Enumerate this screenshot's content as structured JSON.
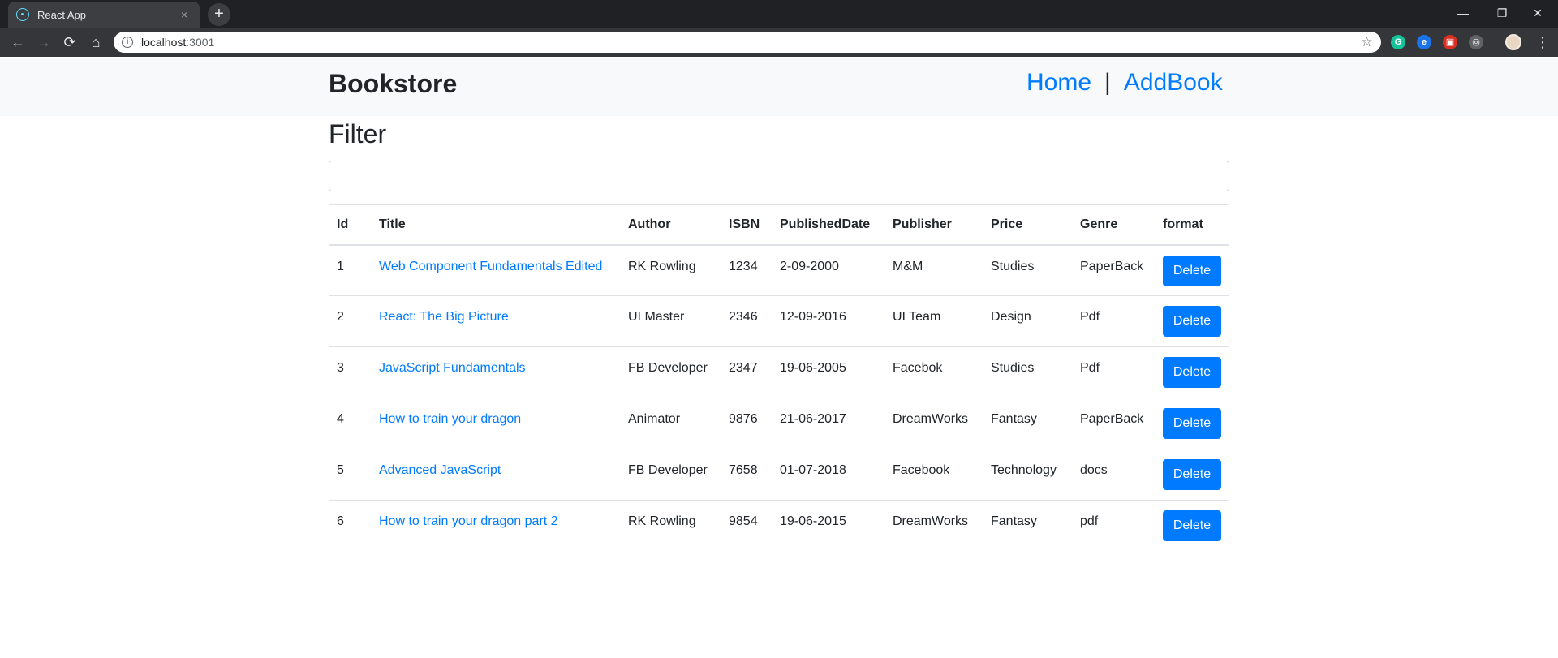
{
  "browser": {
    "tab_title": "React App",
    "tab_close": "×",
    "new_tab": "+",
    "back": "←",
    "forward": "→",
    "reload": "⟳",
    "home": "⌂",
    "url_host": "localhost",
    "url_port": ":3001",
    "star": "☆",
    "minimize": "—",
    "restore": "❐",
    "close": "✕",
    "menu": "⋮",
    "extensions": [
      {
        "name": "grammarly-icon",
        "glyph": "G",
        "color": "#15c39a"
      },
      {
        "name": "extension-blue-icon",
        "glyph": "e",
        "color": "#1a73e8"
      },
      {
        "name": "extension-red-icon",
        "glyph": "▣",
        "color": "#d93025"
      },
      {
        "name": "extension-target-icon",
        "glyph": "◎",
        "color": "#5f6368"
      }
    ]
  },
  "navbar": {
    "brand": "Bookstore",
    "links": [
      {
        "label": "Home"
      },
      {
        "label": "AddBook"
      }
    ],
    "separator": "|"
  },
  "filter": {
    "title": "Filter",
    "value": "",
    "placeholder": ""
  },
  "table": {
    "headers": [
      "Id",
      "Title",
      "Author",
      "ISBN",
      "PublishedDate",
      "Publisher",
      "Price",
      "Genre",
      "format"
    ],
    "rows": [
      {
        "id": "1",
        "title": "Web Component Fundamentals Edited",
        "author": "RK Rowling",
        "isbn": "1234",
        "date": "2-09-2000",
        "publisher": "M&M",
        "price": "Studies",
        "genre": "PaperBack",
        "action": "Delete"
      },
      {
        "id": "2",
        "title": "React: The Big Picture",
        "author": "UI Master",
        "isbn": "2346",
        "date": "12-09-2016",
        "publisher": "UI Team",
        "price": "Design",
        "genre": "Pdf",
        "action": "Delete"
      },
      {
        "id": "3",
        "title": "JavaScript Fundamentals",
        "author": "FB Developer",
        "isbn": "2347",
        "date": "19-06-2005",
        "publisher": "Facebok",
        "price": "Studies",
        "genre": "Pdf",
        "action": "Delete"
      },
      {
        "id": "4",
        "title": "How to train your dragon",
        "author": "Animator",
        "isbn": "9876",
        "date": "21-06-2017",
        "publisher": "DreamWorks",
        "price": "Fantasy",
        "genre": "PaperBack",
        "action": "Delete"
      },
      {
        "id": "5",
        "title": "Advanced JavaScript",
        "author": "FB Developer",
        "isbn": "7658",
        "date": "01-07-2018",
        "publisher": "Facebook",
        "price": "Technology",
        "genre": "docs",
        "action": "Delete"
      },
      {
        "id": "6",
        "title": "How to train your dragon part 2",
        "author": "RK Rowling",
        "isbn": "9854",
        "date": "19-06-2015",
        "publisher": "DreamWorks",
        "price": "Fantasy",
        "genre": "pdf",
        "action": "Delete"
      }
    ]
  },
  "colors": {
    "primary": "#007bff",
    "navbar_bg": "#f8f9fa",
    "text": "#212529"
  }
}
